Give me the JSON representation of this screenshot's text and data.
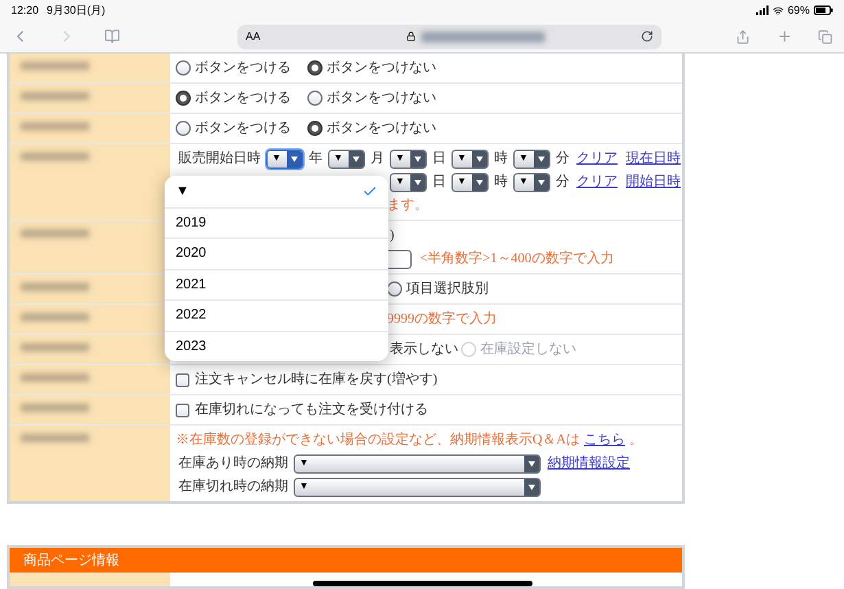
{
  "status_bar": {
    "time": "12:20",
    "date": "9月30日(月)",
    "battery": "69%"
  },
  "browser_toolbar": {
    "text_size": "AA"
  },
  "form": {
    "rows": [
      {
        "lines": [
          {
            "parts": [
              {
                "kind": "radio",
                "label": "ボタンをつける",
                "selected": false
              },
              {
                "kind": "radio",
                "label": "ボタンをつけない",
                "selected": true
              }
            ]
          }
        ]
      },
      {
        "lines": [
          {
            "parts": [
              {
                "kind": "radio",
                "label": "ボタンをつける",
                "selected": true
              },
              {
                "kind": "radio",
                "label": "ボタンをつけない",
                "selected": false
              }
            ]
          }
        ]
      },
      {
        "lines": [
          {
            "parts": [
              {
                "kind": "radio",
                "label": "ボタンをつける",
                "selected": false
              },
              {
                "kind": "radio",
                "label": "ボタンをつけない",
                "selected": true
              }
            ]
          }
        ]
      },
      {
        "lines": [
          {
            "parts": [
              {
                "kind": "text",
                "text": "販売開始日時"
              },
              {
                "kind": "select",
                "value": "▼",
                "focused": true
              },
              {
                "kind": "text",
                "text": "年"
              },
              {
                "kind": "select",
                "value": "▼",
                "focused": false
              },
              {
                "kind": "text",
                "text": "月"
              },
              {
                "kind": "select",
                "value": "▼",
                "focused": false
              },
              {
                "kind": "text",
                "text": "日"
              },
              {
                "kind": "select",
                "value": "▼",
                "focused": false
              },
              {
                "kind": "text",
                "text": "時"
              },
              {
                "kind": "select",
                "value": "▼",
                "focused": false
              },
              {
                "kind": "text",
                "text": "分"
              },
              {
                "kind": "link",
                "text": "クリア"
              },
              {
                "kind": "link",
                "text": "現在日時"
              }
            ]
          },
          {
            "parts": [
              {
                "kind": "select",
                "value": "▼",
                "focused": false
              },
              {
                "kind": "text",
                "text": "日"
              },
              {
                "kind": "select",
                "value": "▼",
                "focused": false
              },
              {
                "kind": "text",
                "text": "時"
              },
              {
                "kind": "select",
                "value": "▼",
                "focused": false
              },
              {
                "kind": "text",
                "text": "分"
              },
              {
                "kind": "link",
                "text": "クリア"
              },
              {
                "kind": "link",
                "text": "開始日時"
              }
            ]
          },
          {
            "parts": [
              {
                "kind": "note",
                "text": "ます。"
              }
            ]
          }
        ]
      },
      {
        "lines": [
          {
            "parts": [
              {
                "kind": "text",
                "text": ")"
              }
            ]
          },
          {
            "parts": [
              {
                "kind": "input"
              },
              {
                "kind": "note",
                "text": "<半角数字>1～400の数字で入力"
              }
            ]
          }
        ]
      },
      {
        "lines": [
          {
            "parts": [
              {
                "kind": "radio",
                "label": "項目選択肢別",
                "selected": false
              }
            ]
          }
        ]
      },
      {
        "lines": [
          {
            "parts": [
              {
                "kind": "note",
                "text": "9999の数字で入力"
              }
            ]
          }
        ]
      },
      {
        "lines": [
          {
            "parts": [
              {
                "kind": "text",
                "text": "表示しない"
              },
              {
                "kind": "radio",
                "label": "在庫設定しない",
                "selected": false,
                "disabled": true
              }
            ]
          }
        ]
      },
      {
        "lines": [
          {
            "parts": [
              {
                "kind": "checkbox",
                "label": "注文キャンセル時に在庫を戻す(増やす)",
                "checked": false
              }
            ]
          }
        ]
      },
      {
        "lines": [
          {
            "parts": [
              {
                "kind": "checkbox",
                "label": "在庫切れになっても注文を受け付ける",
                "checked": false
              }
            ]
          }
        ]
      },
      {
        "lines": [
          {
            "parts": [
              {
                "kind": "note",
                "text": "※在庫数の登録ができない場合の設定など、納期情報表示Q＆Aは"
              },
              {
                "kind": "link",
                "text": "こちら"
              },
              {
                "kind": "note",
                "text": "。"
              }
            ]
          },
          {
            "parts": [
              {
                "kind": "text",
                "text": "在庫あり時の納期"
              },
              {
                "kind": "select",
                "value": "▼",
                "focused": false,
                "wide": true
              },
              {
                "kind": "link",
                "text": "納期情報設定"
              }
            ]
          },
          {
            "parts": [
              {
                "kind": "text",
                "text": "在庫切れ時の納期"
              },
              {
                "kind": "select",
                "value": "▼",
                "focused": false,
                "wide": true
              }
            ]
          }
        ]
      }
    ]
  },
  "year_picker": {
    "options": [
      {
        "label": "▼",
        "selected": true
      },
      {
        "label": "2019",
        "selected": false
      },
      {
        "label": "2020",
        "selected": false
      },
      {
        "label": "2021",
        "selected": false
      },
      {
        "label": "2022",
        "selected": false
      },
      {
        "label": "2023",
        "selected": false
      }
    ]
  },
  "section_header": {
    "title": "商品ページ情報"
  }
}
